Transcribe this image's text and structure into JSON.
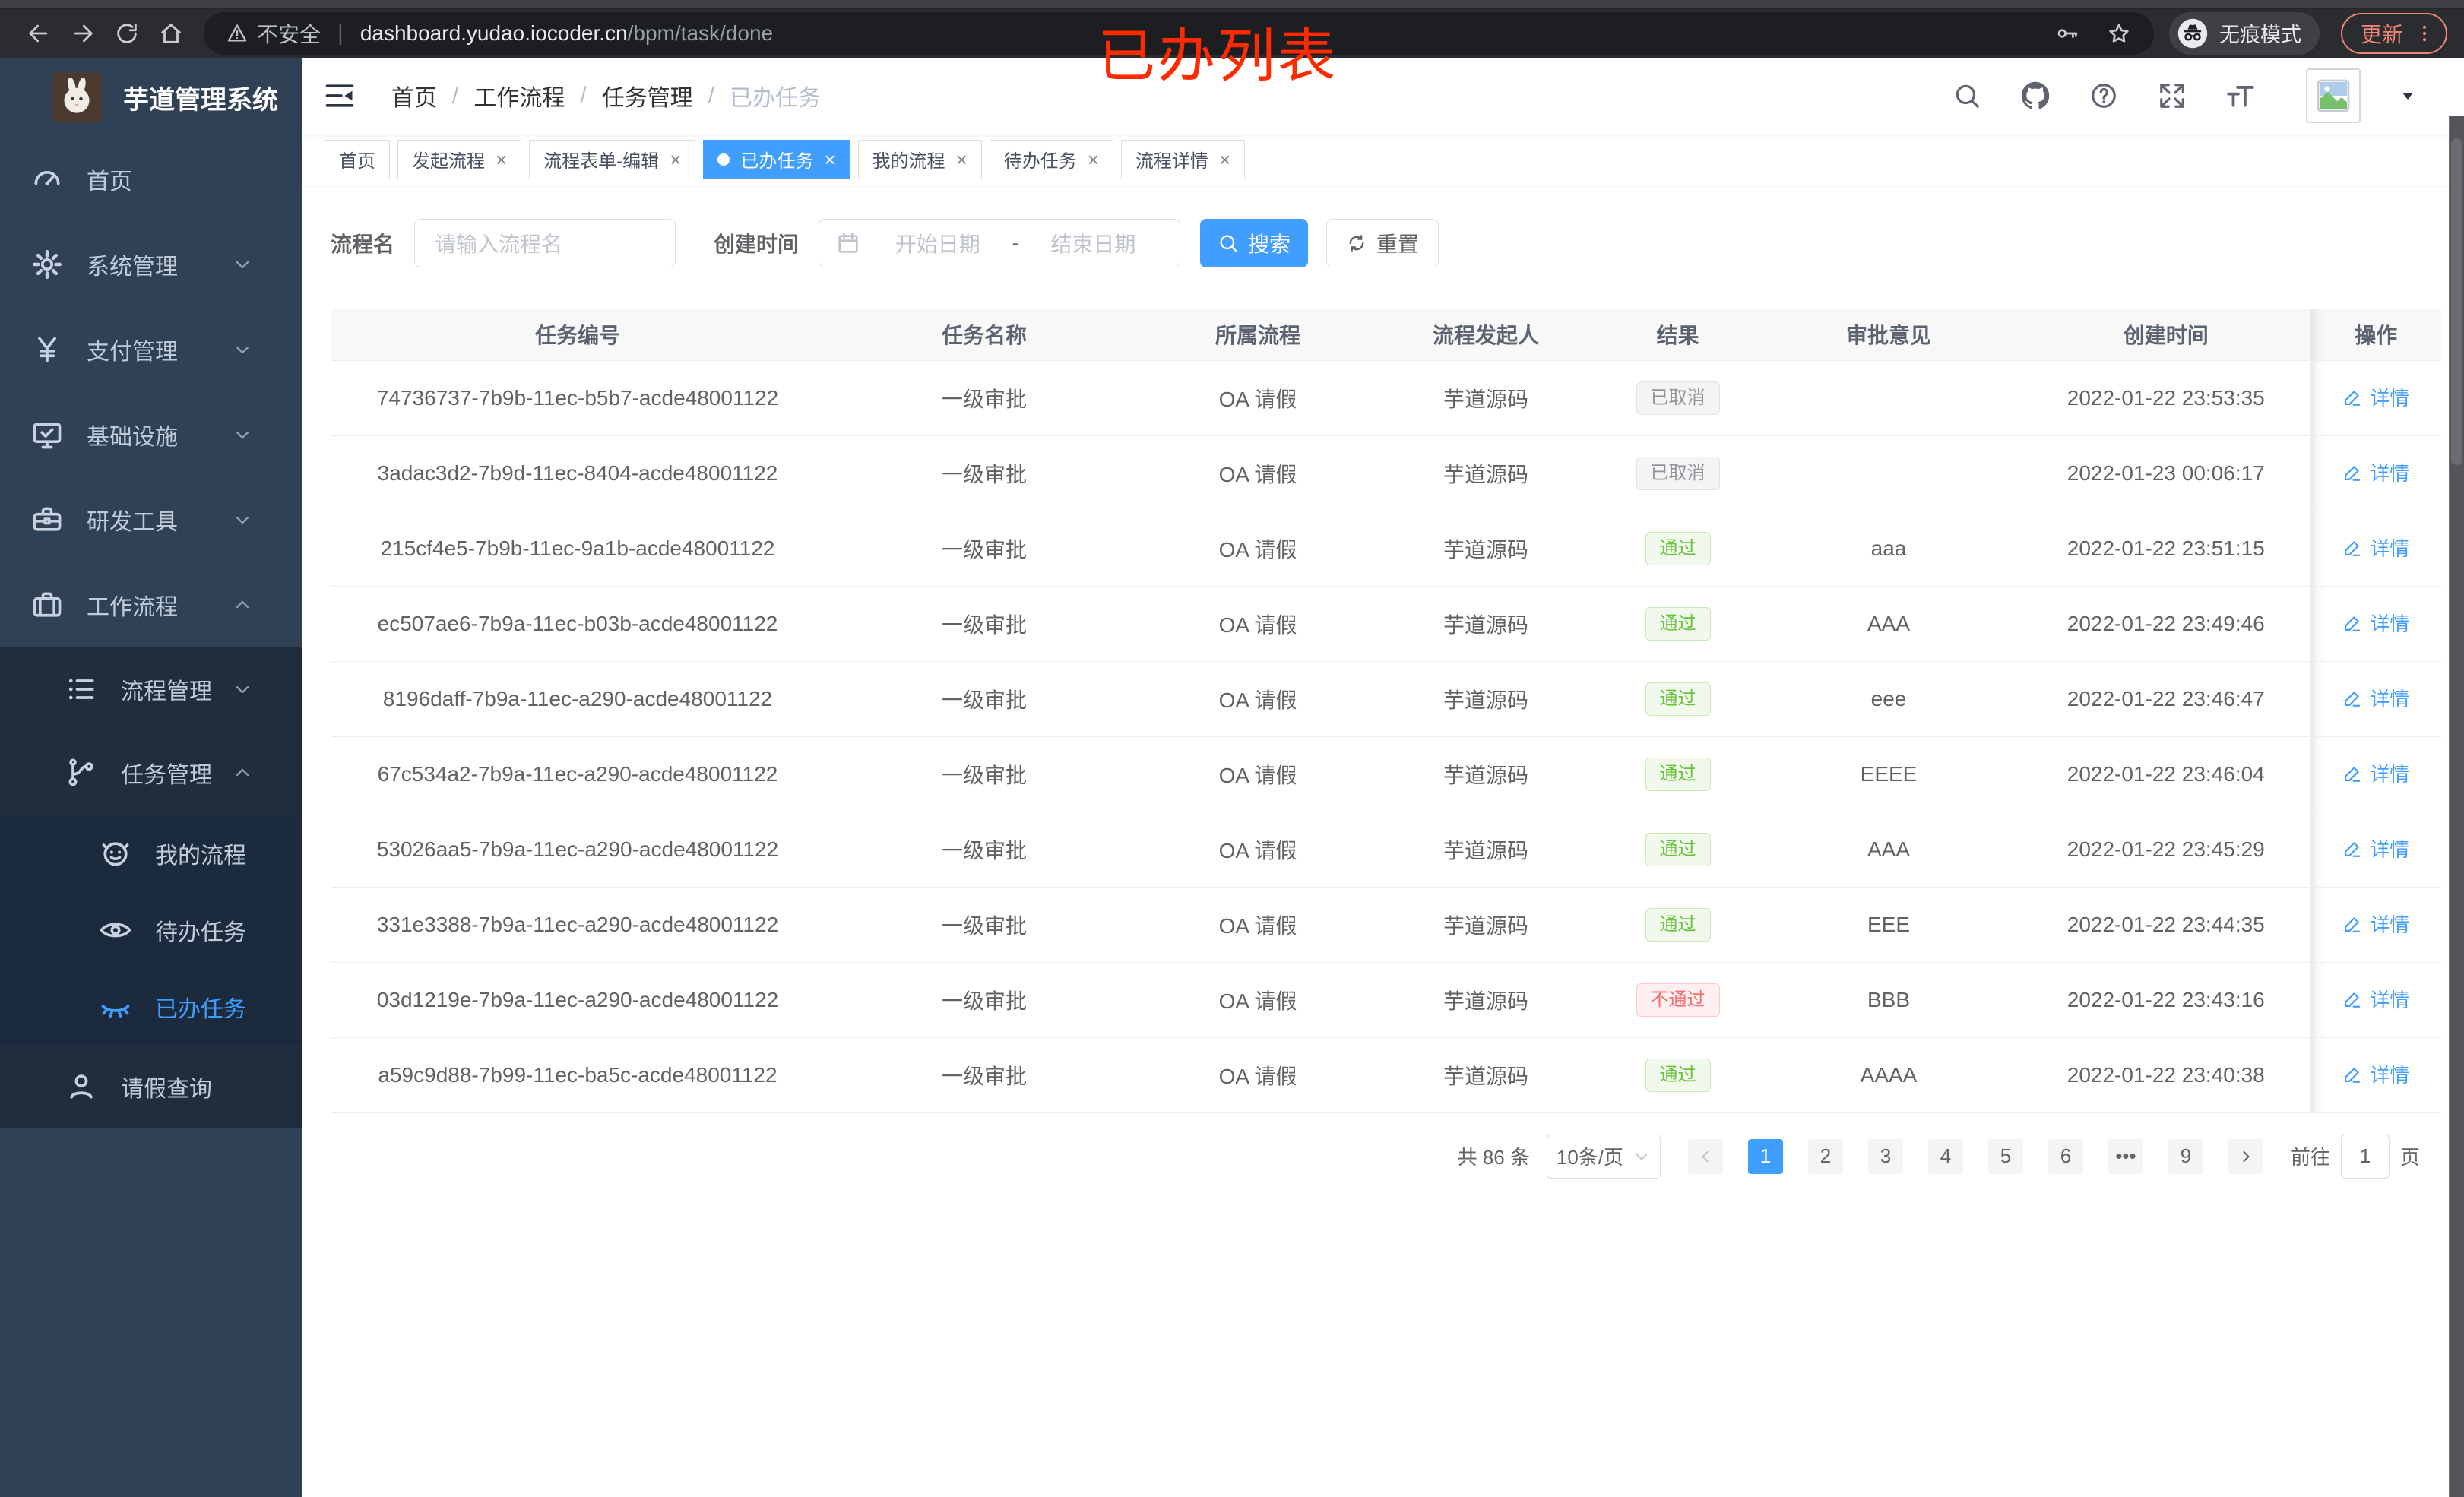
{
  "annotation": {
    "label": "已办列表"
  },
  "colors": {
    "accent": "#409eff",
    "success": "#67c23a",
    "danger": "#f56c6c",
    "info": "#909399",
    "annotation_red": "#ff2a00",
    "update_red": "#ee8577",
    "sidebar_bg": "#304156",
    "submenu_bg": "#1f2d3d"
  },
  "browser": {
    "security_label": "不安全",
    "url_host": "dashboard.yudao.iocoder.cn",
    "url_path": "/bpm/task/done",
    "incognito_label": "无痕模式",
    "update_label": "更新"
  },
  "sidebar": {
    "app_title": "芋道管理系统",
    "top_menu": [
      {
        "key": "home",
        "label": "首页",
        "icon": "gauge-icon"
      },
      {
        "key": "system",
        "label": "系统管理",
        "icon": "gear-icon",
        "chevron": "down"
      },
      {
        "key": "payment",
        "label": "支付管理",
        "icon": "yen-icon",
        "chevron": "down"
      },
      {
        "key": "infra",
        "label": "基础设施",
        "icon": "monitor-icon",
        "chevron": "down"
      },
      {
        "key": "devtools",
        "label": "研发工具",
        "icon": "toolbox-icon",
        "chevron": "down"
      },
      {
        "key": "workflow",
        "label": "工作流程",
        "icon": "briefcase-icon",
        "chevron": "up"
      }
    ],
    "workflow_submenu": [
      {
        "key": "process-mgmt",
        "label": "流程管理",
        "icon": "tree-list-icon",
        "chevron": "down"
      },
      {
        "key": "task-mgmt",
        "label": "任务管理",
        "icon": "branch-icon",
        "chevron": "up",
        "children": [
          {
            "key": "my-process",
            "label": "我的流程",
            "icon": "robot-icon"
          },
          {
            "key": "todo-tasks",
            "label": "待办任务",
            "icon": "eye-icon"
          },
          {
            "key": "done-tasks",
            "label": "已办任务",
            "icon": "eye-closed-icon",
            "active": true
          }
        ]
      },
      {
        "key": "leave-query",
        "label": "请假查询",
        "icon": "user-icon"
      }
    ]
  },
  "navbar": {
    "breadcrumb": [
      "首页",
      "工作流程",
      "任务管理",
      "已办任务"
    ]
  },
  "tags": [
    {
      "key": "home",
      "label": "首页"
    },
    {
      "key": "start-process",
      "label": "发起流程",
      "closable": true
    },
    {
      "key": "form-edit",
      "label": "流程表单-编辑",
      "closable": true
    },
    {
      "key": "done-tasks",
      "label": "已办任务",
      "closable": true,
      "active": true
    },
    {
      "key": "my-process",
      "label": "我的流程",
      "closable": true
    },
    {
      "key": "todo-tasks",
      "label": "待办任务",
      "closable": true
    },
    {
      "key": "process-detail",
      "label": "流程详情",
      "closable": true
    }
  ],
  "filters": {
    "name_label": "流程名",
    "name_placeholder": "请输入流程名",
    "time_label": "创建时间",
    "start_placeholder": "开始日期",
    "range_separator": "-",
    "end_placeholder": "结束日期",
    "search_label": "搜索",
    "reset_label": "重置"
  },
  "table": {
    "columns": [
      "任务编号",
      "任务名称",
      "所属流程",
      "流程发起人",
      "结果",
      "审批意见",
      "创建时间",
      "操作"
    ],
    "detail_label": "详情",
    "rows": [
      {
        "id": "74736737-7b9b-11ec-b5b7-acde48001122",
        "name": "一级审批",
        "process": "OA 请假",
        "starter": "芋道源码",
        "result": "已取消",
        "result_type": "info",
        "comment": "",
        "time": "2022-01-22 23:53:35"
      },
      {
        "id": "3adac3d2-7b9d-11ec-8404-acde48001122",
        "name": "一级审批",
        "process": "OA 请假",
        "starter": "芋道源码",
        "result": "已取消",
        "result_type": "info",
        "comment": "",
        "time": "2022-01-23 00:06:17"
      },
      {
        "id": "215cf4e5-7b9b-11ec-9a1b-acde48001122",
        "name": "一级审批",
        "process": "OA 请假",
        "starter": "芋道源码",
        "result": "通过",
        "result_type": "success",
        "comment": "aaa",
        "time": "2022-01-22 23:51:15"
      },
      {
        "id": "ec507ae6-7b9a-11ec-b03b-acde48001122",
        "name": "一级审批",
        "process": "OA 请假",
        "starter": "芋道源码",
        "result": "通过",
        "result_type": "success",
        "comment": "AAA",
        "time": "2022-01-22 23:49:46"
      },
      {
        "id": "8196daff-7b9a-11ec-a290-acde48001122",
        "name": "一级审批",
        "process": "OA 请假",
        "starter": "芋道源码",
        "result": "通过",
        "result_type": "success",
        "comment": "eee",
        "time": "2022-01-22 23:46:47"
      },
      {
        "id": "67c534a2-7b9a-11ec-a290-acde48001122",
        "name": "一级审批",
        "process": "OA 请假",
        "starter": "芋道源码",
        "result": "通过",
        "result_type": "success",
        "comment": "EEEE",
        "time": "2022-01-22 23:46:04"
      },
      {
        "id": "53026aa5-7b9a-11ec-a290-acde48001122",
        "name": "一级审批",
        "process": "OA 请假",
        "starter": "芋道源码",
        "result": "通过",
        "result_type": "success",
        "comment": "AAA",
        "time": "2022-01-22 23:45:29"
      },
      {
        "id": "331e3388-7b9a-11ec-a290-acde48001122",
        "name": "一级审批",
        "process": "OA 请假",
        "starter": "芋道源码",
        "result": "通过",
        "result_type": "success",
        "comment": "EEE",
        "time": "2022-01-22 23:44:35"
      },
      {
        "id": "03d1219e-7b9a-11ec-a290-acde48001122",
        "name": "一级审批",
        "process": "OA 请假",
        "starter": "芋道源码",
        "result": "不通过",
        "result_type": "danger",
        "comment": "BBB",
        "time": "2022-01-22 23:43:16"
      },
      {
        "id": "a59c9d88-7b99-11ec-ba5c-acde48001122",
        "name": "一级审批",
        "process": "OA 请假",
        "starter": "芋道源码",
        "result": "通过",
        "result_type": "success",
        "comment": "AAAA",
        "time": "2022-01-22 23:40:38"
      }
    ]
  },
  "pagination": {
    "total_label": "共 86 条",
    "page_size_label": "10条/页",
    "pages": [
      "1",
      "2",
      "3",
      "4",
      "5",
      "6",
      "...",
      "9"
    ],
    "active_page": "1",
    "goto_label": "前往",
    "goto_value": "1",
    "unit_label": "页"
  }
}
